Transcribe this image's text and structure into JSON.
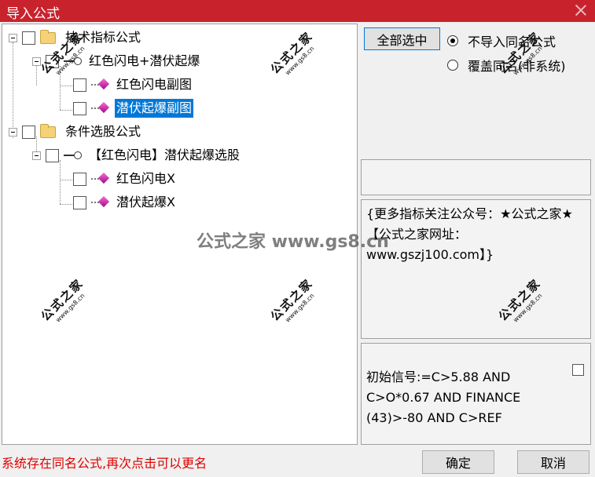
{
  "window": {
    "title": "导入公式"
  },
  "tree": {
    "root1": {
      "label": "技术指标公式"
    },
    "root1_child": {
      "label": "红色闪电+潜伏起爆"
    },
    "root1_leaf1": {
      "label": "红色闪电副图"
    },
    "root1_leaf2": {
      "label": "潜伏起爆副图"
    },
    "root2": {
      "label": "条件选股公式"
    },
    "root2_child": {
      "label": "【红色闪电】潜伏起爆选股"
    },
    "root2_leaf1": {
      "label": "红色闪电X"
    },
    "root2_leaf2": {
      "label": "潜伏起爆X"
    }
  },
  "options": {
    "select_all_label": "全部选中",
    "radio_no_import": "不导入同名公式",
    "radio_overwrite": "覆盖同名(非系统)",
    "selected": "no_import"
  },
  "description": "{更多指标关注公众号：★公式之家★【公式之家网址：www.gszj100.com】}",
  "formula": "初始信号:=C>5.88 AND C>O*0.67 AND FINANCE (43)>-80 AND C>REF",
  "status_text": "系统存在同名公式,再次点击可以更名",
  "buttons": {
    "ok": "确定",
    "cancel": "取消"
  },
  "watermark": {
    "brand": "公式之家",
    "url_small": "www.gs8.cn",
    "center": "公式之家 www.gs8.cn"
  },
  "colors": {
    "titlebar": "#c8232c",
    "selection": "#0078d7",
    "status": "#e00000"
  }
}
